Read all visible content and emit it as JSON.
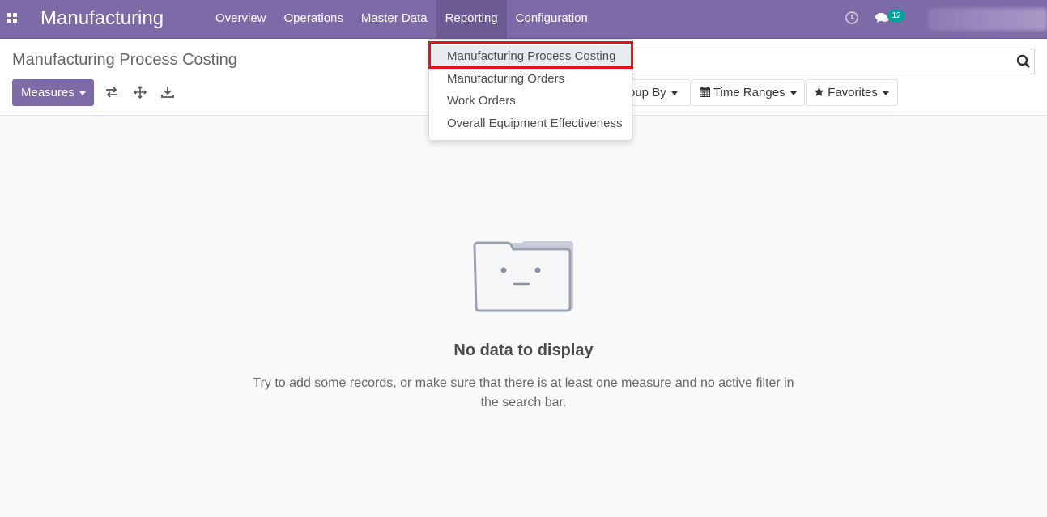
{
  "navbar": {
    "app_title": "Manufacturing",
    "menu": [
      "Overview",
      "Operations",
      "Master Data",
      "Reporting",
      "Configuration"
    ],
    "active_menu": "Reporting",
    "chat_count": "12",
    "bg_color": "#7c6ba6"
  },
  "dropdown": {
    "items": [
      "Manufacturing Process Costing",
      "Manufacturing Orders",
      "Work Orders",
      "Overall Equipment Effectiveness"
    ],
    "highlight_color": "#e0141c"
  },
  "control_panel": {
    "title": "Manufacturing Process Costing",
    "measures_label": "Measures",
    "filters": [
      "roup By",
      "Time Ranges",
      "Favorites"
    ],
    "search_placeholder": ""
  },
  "empty_state": {
    "title": "No data to display",
    "help": "Try to add some records, or make sure that there is at least one measure and no active filter in the search bar."
  }
}
